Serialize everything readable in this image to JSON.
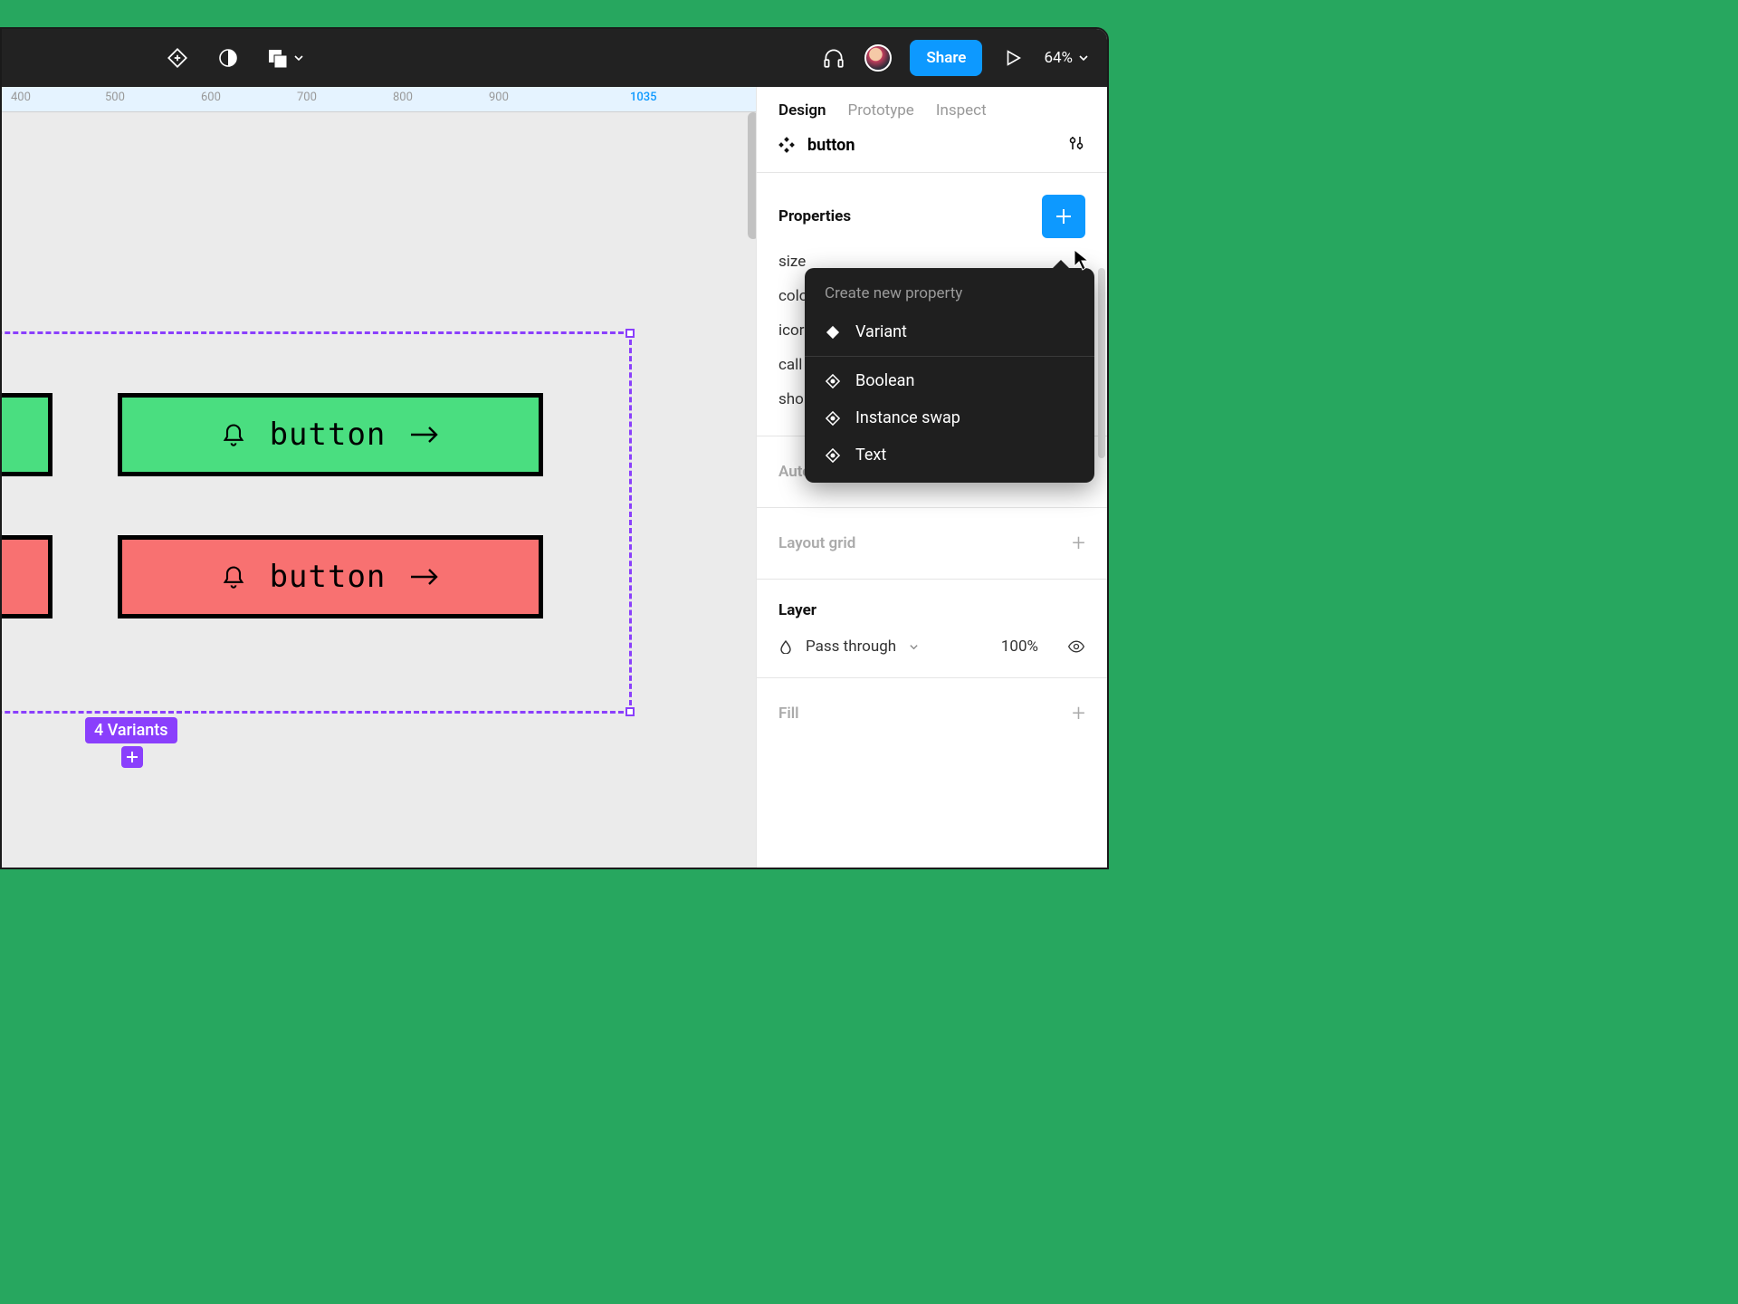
{
  "toolbar": {
    "share_label": "Share",
    "zoom": "64%"
  },
  "ruler": {
    "ticks": [
      "400",
      "500",
      "600",
      "700",
      "800",
      "900"
    ],
    "active_tick": "1035"
  },
  "canvas": {
    "button_label": "button",
    "variants_badge": "4 Variants",
    "colors": {
      "green": "#4ade80",
      "red": "#f87171",
      "selection": "#8a3ffc"
    }
  },
  "panel": {
    "tabs": {
      "design": "Design",
      "prototype": "Prototype",
      "inspect": "Inspect"
    },
    "component_name": "button",
    "properties_title": "Properties",
    "properties": [
      "size",
      "colo",
      "icor",
      "call",
      "sho"
    ],
    "auto_layout": "Auto layout",
    "layout_grid": "Layout grid",
    "layer_title": "Layer",
    "blend_mode": "Pass through",
    "opacity": "100%",
    "fill_title": "Fill"
  },
  "popover": {
    "title": "Create new property",
    "items": {
      "variant": "Variant",
      "boolean": "Boolean",
      "instance_swap": "Instance swap",
      "text": "Text"
    }
  }
}
